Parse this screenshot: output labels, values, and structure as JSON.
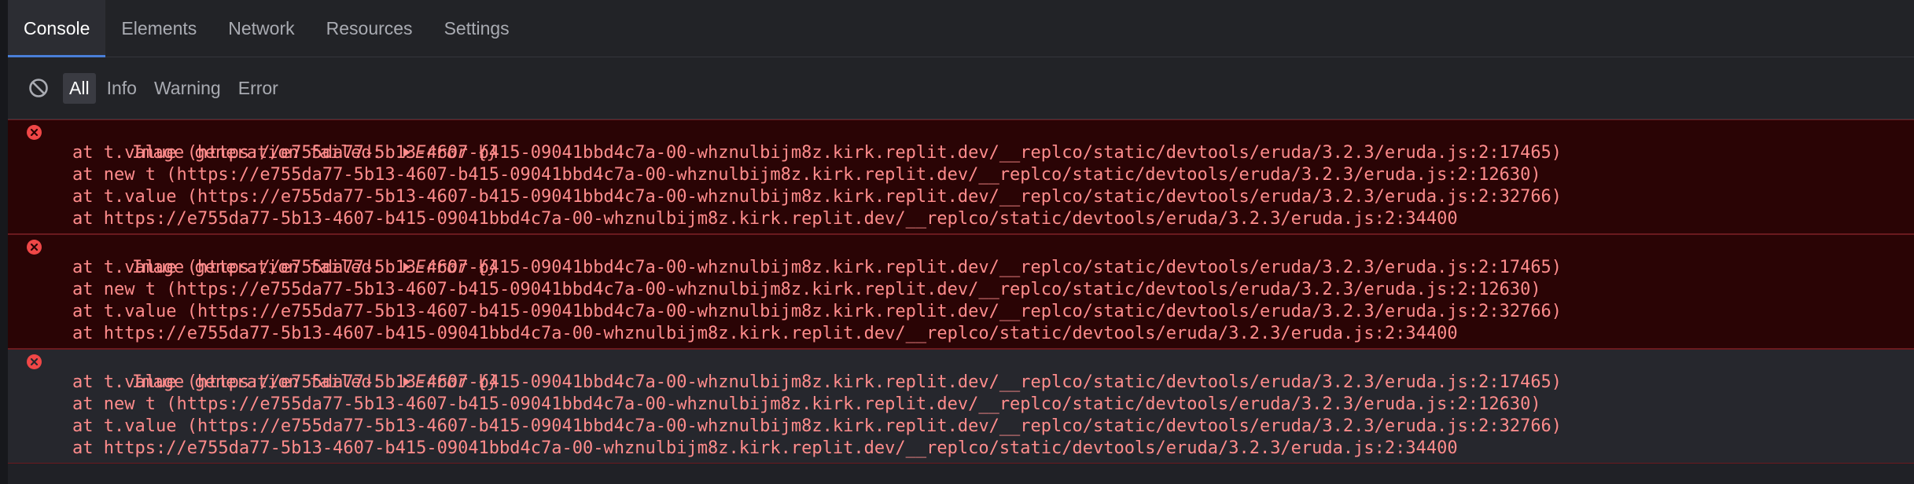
{
  "tabs": [
    {
      "label": "Console",
      "active": true
    },
    {
      "label": "Elements",
      "active": false
    },
    {
      "label": "Network",
      "active": false
    },
    {
      "label": "Resources",
      "active": false
    },
    {
      "label": "Settings",
      "active": false
    }
  ],
  "toolbar": {
    "clear_icon": "clear-console-icon",
    "filters": [
      {
        "label": "All",
        "active": true
      },
      {
        "label": "Info",
        "active": false
      },
      {
        "label": "Warning",
        "active": false
      },
      {
        "label": "Error",
        "active": false
      }
    ]
  },
  "logs": [
    {
      "level": "error",
      "message": "Image generation failed: ",
      "object": "Error {}",
      "stack": [
        "at t.value (https://e755da77-5b13-4607-b415-09041bbd4c7a-00-whznulbijm8z.kirk.replit.dev/__replco/static/devtools/eruda/3.2.3/eruda.js:2:17465)",
        "at new t (https://e755da77-5b13-4607-b415-09041bbd4c7a-00-whznulbijm8z.kirk.replit.dev/__replco/static/devtools/eruda/3.2.3/eruda.js:2:12630)",
        "at t.value (https://e755da77-5b13-4607-b415-09041bbd4c7a-00-whznulbijm8z.kirk.replit.dev/__replco/static/devtools/eruda/3.2.3/eruda.js:2:32766)",
        "at https://e755da77-5b13-4607-b415-09041bbd4c7a-00-whznulbijm8z.kirk.replit.dev/__replco/static/devtools/eruda/3.2.3/eruda.js:2:34400"
      ]
    },
    {
      "level": "error",
      "message": "Image generation failed: ",
      "object": "Error {}",
      "stack": [
        "at t.value (https://e755da77-5b13-4607-b415-09041bbd4c7a-00-whznulbijm8z.kirk.replit.dev/__replco/static/devtools/eruda/3.2.3/eruda.js:2:17465)",
        "at new t (https://e755da77-5b13-4607-b415-09041bbd4c7a-00-whznulbijm8z.kirk.replit.dev/__replco/static/devtools/eruda/3.2.3/eruda.js:2:12630)",
        "at t.value (https://e755da77-5b13-4607-b415-09041bbd4c7a-00-whznulbijm8z.kirk.replit.dev/__replco/static/devtools/eruda/3.2.3/eruda.js:2:32766)",
        "at https://e755da77-5b13-4607-b415-09041bbd4c7a-00-whznulbijm8z.kirk.replit.dev/__replco/static/devtools/eruda/3.2.3/eruda.js:2:34400"
      ]
    },
    {
      "level": "error",
      "message": "Image generation failed: ",
      "object": "Error {}",
      "stack": [
        "at t.value (https://e755da77-5b13-4607-b415-09041bbd4c7a-00-whznulbijm8z.kirk.replit.dev/__replco/static/devtools/eruda/3.2.3/eruda.js:2:17465)",
        "at new t (https://e755da77-5b13-4607-b415-09041bbd4c7a-00-whznulbijm8z.kirk.replit.dev/__replco/static/devtools/eruda/3.2.3/eruda.js:2:12630)",
        "at t.value (https://e755da77-5b13-4607-b415-09041bbd4c7a-00-whznulbijm8z.kirk.replit.dev/__replco/static/devtools/eruda/3.2.3/eruda.js:2:32766)",
        "at https://e755da77-5b13-4607-b415-09041bbd4c7a-00-whznulbijm8z.kirk.replit.dev/__replco/static/devtools/eruda/3.2.3/eruda.js:2:34400"
      ]
    }
  ]
}
